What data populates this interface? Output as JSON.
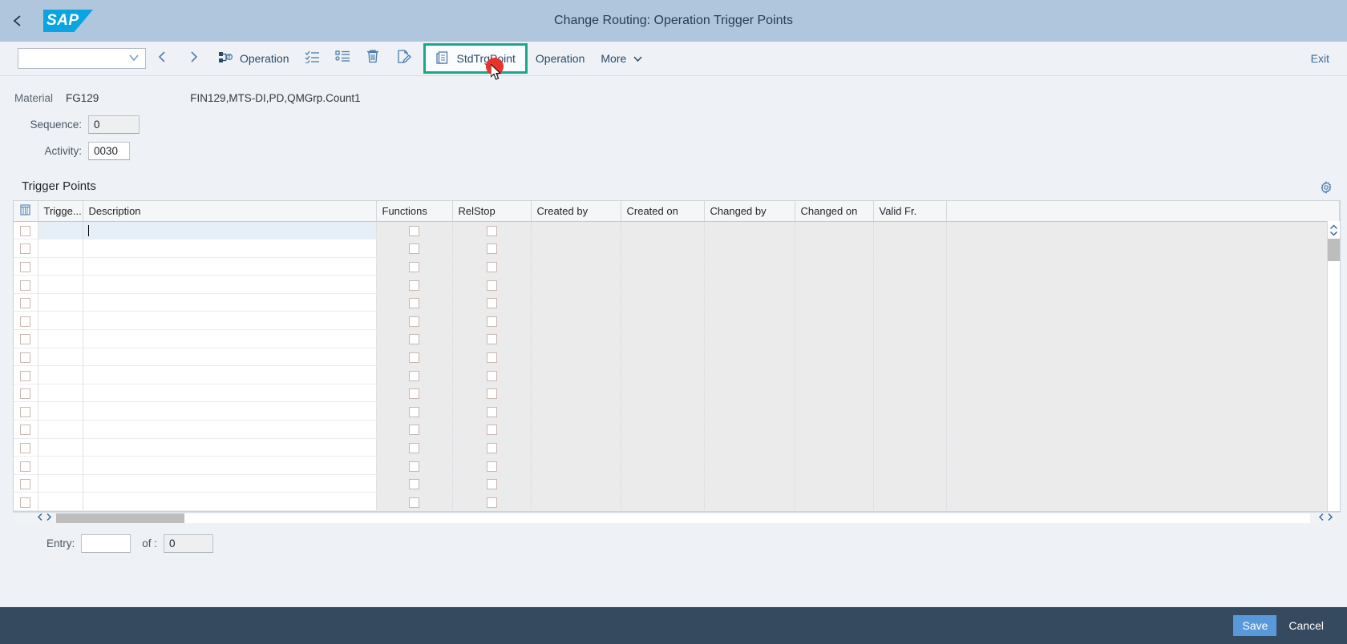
{
  "shell": {
    "title": "Change Routing: Operation Trigger Points",
    "logo_text": "SAP",
    "back_icon": "back-chevron-icon"
  },
  "toolbar": {
    "variant_select_value": "",
    "prev_icon": "chevron-left-icon",
    "next_icon": "chevron-right-icon",
    "operation_label": "Operation",
    "select_all_icon": "checklist-icon",
    "list_icon": "bullet-list-icon",
    "delete_icon": "trash-icon",
    "edit_icon": "edit-document-icon",
    "stdtrgpoint_label": "StdTrgPoint",
    "stdtrgpoint_icon": "copy-document-icon",
    "operation_menu_label": "Operation",
    "more_label": "More",
    "more_icon": "chevron-down-icon",
    "exit_label": "Exit"
  },
  "info": {
    "material_label": "Material",
    "material_value": "FG129",
    "material_description": "FIN129,MTS-DI,PD,QMGrp.Count1",
    "sequence_label": "Sequence:",
    "sequence_value": "0",
    "activity_label": "Activity:",
    "activity_value": "0030"
  },
  "trigger_points": {
    "section_title": "Trigger Points",
    "settings_icon": "gear-icon",
    "column_config_icon": "column-settings-icon",
    "columns": [
      "Trigge...",
      "Description",
      "Functions",
      "RelStop",
      "Created by",
      "Created on",
      "Changed by",
      "Changed on",
      "Valid Fr.",
      ""
    ],
    "row_count": 16,
    "active_row_index": 0,
    "rows": [
      {
        "trigger": "",
        "description": "",
        "functions": false,
        "relstop": false,
        "created_by": "",
        "created_on": "",
        "changed_by": "",
        "changed_on": "",
        "valid_from": ""
      },
      {
        "trigger": "",
        "description": "",
        "functions": false,
        "relstop": false,
        "created_by": "",
        "created_on": "",
        "changed_by": "",
        "changed_on": "",
        "valid_from": ""
      },
      {
        "trigger": "",
        "description": "",
        "functions": false,
        "relstop": false,
        "created_by": "",
        "created_on": "",
        "changed_by": "",
        "changed_on": "",
        "valid_from": ""
      },
      {
        "trigger": "",
        "description": "",
        "functions": false,
        "relstop": false,
        "created_by": "",
        "created_on": "",
        "changed_by": "",
        "changed_on": "",
        "valid_from": ""
      },
      {
        "trigger": "",
        "description": "",
        "functions": false,
        "relstop": false,
        "created_by": "",
        "created_on": "",
        "changed_by": "",
        "changed_on": "",
        "valid_from": ""
      },
      {
        "trigger": "",
        "description": "",
        "functions": false,
        "relstop": false,
        "created_by": "",
        "created_on": "",
        "changed_by": "",
        "changed_on": "",
        "valid_from": ""
      },
      {
        "trigger": "",
        "description": "",
        "functions": false,
        "relstop": false,
        "created_by": "",
        "created_on": "",
        "changed_by": "",
        "changed_on": "",
        "valid_from": ""
      },
      {
        "trigger": "",
        "description": "",
        "functions": false,
        "relstop": false,
        "created_by": "",
        "created_on": "",
        "changed_by": "",
        "changed_on": "",
        "valid_from": ""
      },
      {
        "trigger": "",
        "description": "",
        "functions": false,
        "relstop": false,
        "created_by": "",
        "created_on": "",
        "changed_by": "",
        "changed_on": "",
        "valid_from": ""
      },
      {
        "trigger": "",
        "description": "",
        "functions": false,
        "relstop": false,
        "created_by": "",
        "created_on": "",
        "changed_by": "",
        "changed_on": "",
        "valid_from": ""
      },
      {
        "trigger": "",
        "description": "",
        "functions": false,
        "relstop": false,
        "created_by": "",
        "created_on": "",
        "changed_by": "",
        "changed_on": "",
        "valid_from": ""
      },
      {
        "trigger": "",
        "description": "",
        "functions": false,
        "relstop": false,
        "created_by": "",
        "created_on": "",
        "changed_by": "",
        "changed_on": "",
        "valid_from": ""
      },
      {
        "trigger": "",
        "description": "",
        "functions": false,
        "relstop": false,
        "created_by": "",
        "created_on": "",
        "changed_by": "",
        "changed_on": "",
        "valid_from": ""
      },
      {
        "trigger": "",
        "description": "",
        "functions": false,
        "relstop": false,
        "created_by": "",
        "created_on": "",
        "changed_by": "",
        "changed_on": "",
        "valid_from": ""
      },
      {
        "trigger": "",
        "description": "",
        "functions": false,
        "relstop": false,
        "created_by": "",
        "created_on": "",
        "changed_by": "",
        "changed_on": "",
        "valid_from": ""
      },
      {
        "trigger": "",
        "description": "",
        "functions": false,
        "relstop": false,
        "created_by": "",
        "created_on": "",
        "changed_by": "",
        "changed_on": "",
        "valid_from": ""
      }
    ]
  },
  "entry": {
    "entry_label": "Entry:",
    "entry_value": "",
    "of_label": "of :",
    "of_value": "0"
  },
  "footer": {
    "save_label": "Save",
    "cancel_label": "Cancel"
  },
  "colors": {
    "shell_header": "#afc6dc",
    "footer": "#354a5f",
    "save_button": "#5899da",
    "highlight_border": "#17a98a",
    "cursor_dot": "#e8332a",
    "sap_blue": "#0aa4e1"
  }
}
